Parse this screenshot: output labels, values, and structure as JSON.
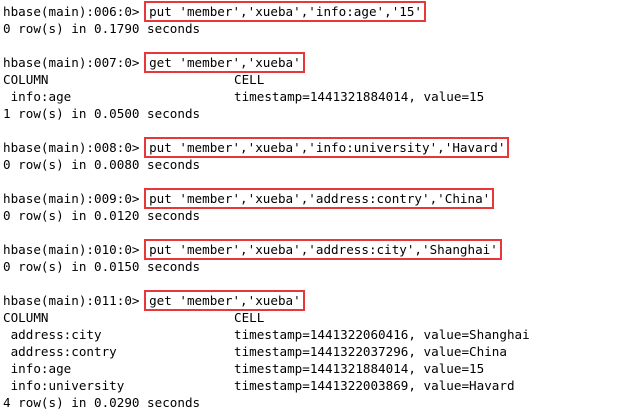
{
  "blocks": [
    {
      "prompt": "hbase(main):006:0> ",
      "command": "put 'member','xueba','info:age','15'",
      "result": "0 row(s) in 0.1790 seconds"
    },
    {
      "prompt": "hbase(main):007:0> ",
      "command": "get 'member','xueba'",
      "header": {
        "column": "COLUMN",
        "cell": "CELL"
      },
      "rows": [
        {
          "column": " info:age",
          "cell": "timestamp=1441321884014, value=15"
        }
      ],
      "result": "1 row(s) in 0.0500 seconds"
    },
    {
      "prompt": "hbase(main):008:0> ",
      "command": "put 'member','xueba','info:university','Havard'",
      "result": "0 row(s) in 0.0080 seconds"
    },
    {
      "prompt": "hbase(main):009:0> ",
      "command": "put 'member','xueba','address:contry','China'",
      "result": "0 row(s) in 0.0120 seconds"
    },
    {
      "prompt": "hbase(main):010:0> ",
      "command": "put 'member','xueba','address:city','Shanghai'",
      "result": "0 row(s) in 0.0150 seconds"
    },
    {
      "prompt": "hbase(main):011:0> ",
      "command": "get 'member','xueba'",
      "header": {
        "column": "COLUMN",
        "cell": "CELL"
      },
      "rows": [
        {
          "column": " address:city",
          "cell": "timestamp=1441322060416, value=Shanghai"
        },
        {
          "column": " address:contry",
          "cell": "timestamp=1441322037296, value=China"
        },
        {
          "column": " info:age",
          "cell": "timestamp=1441321884014, value=15"
        },
        {
          "column": " info:university",
          "cell": "timestamp=1441322003869, value=Havard"
        }
      ],
      "result": "4 row(s) in 0.0290 seconds"
    }
  ],
  "colors": {
    "background": "#ffffff",
    "text": "#000000",
    "highlight_box": "#e8373b"
  }
}
